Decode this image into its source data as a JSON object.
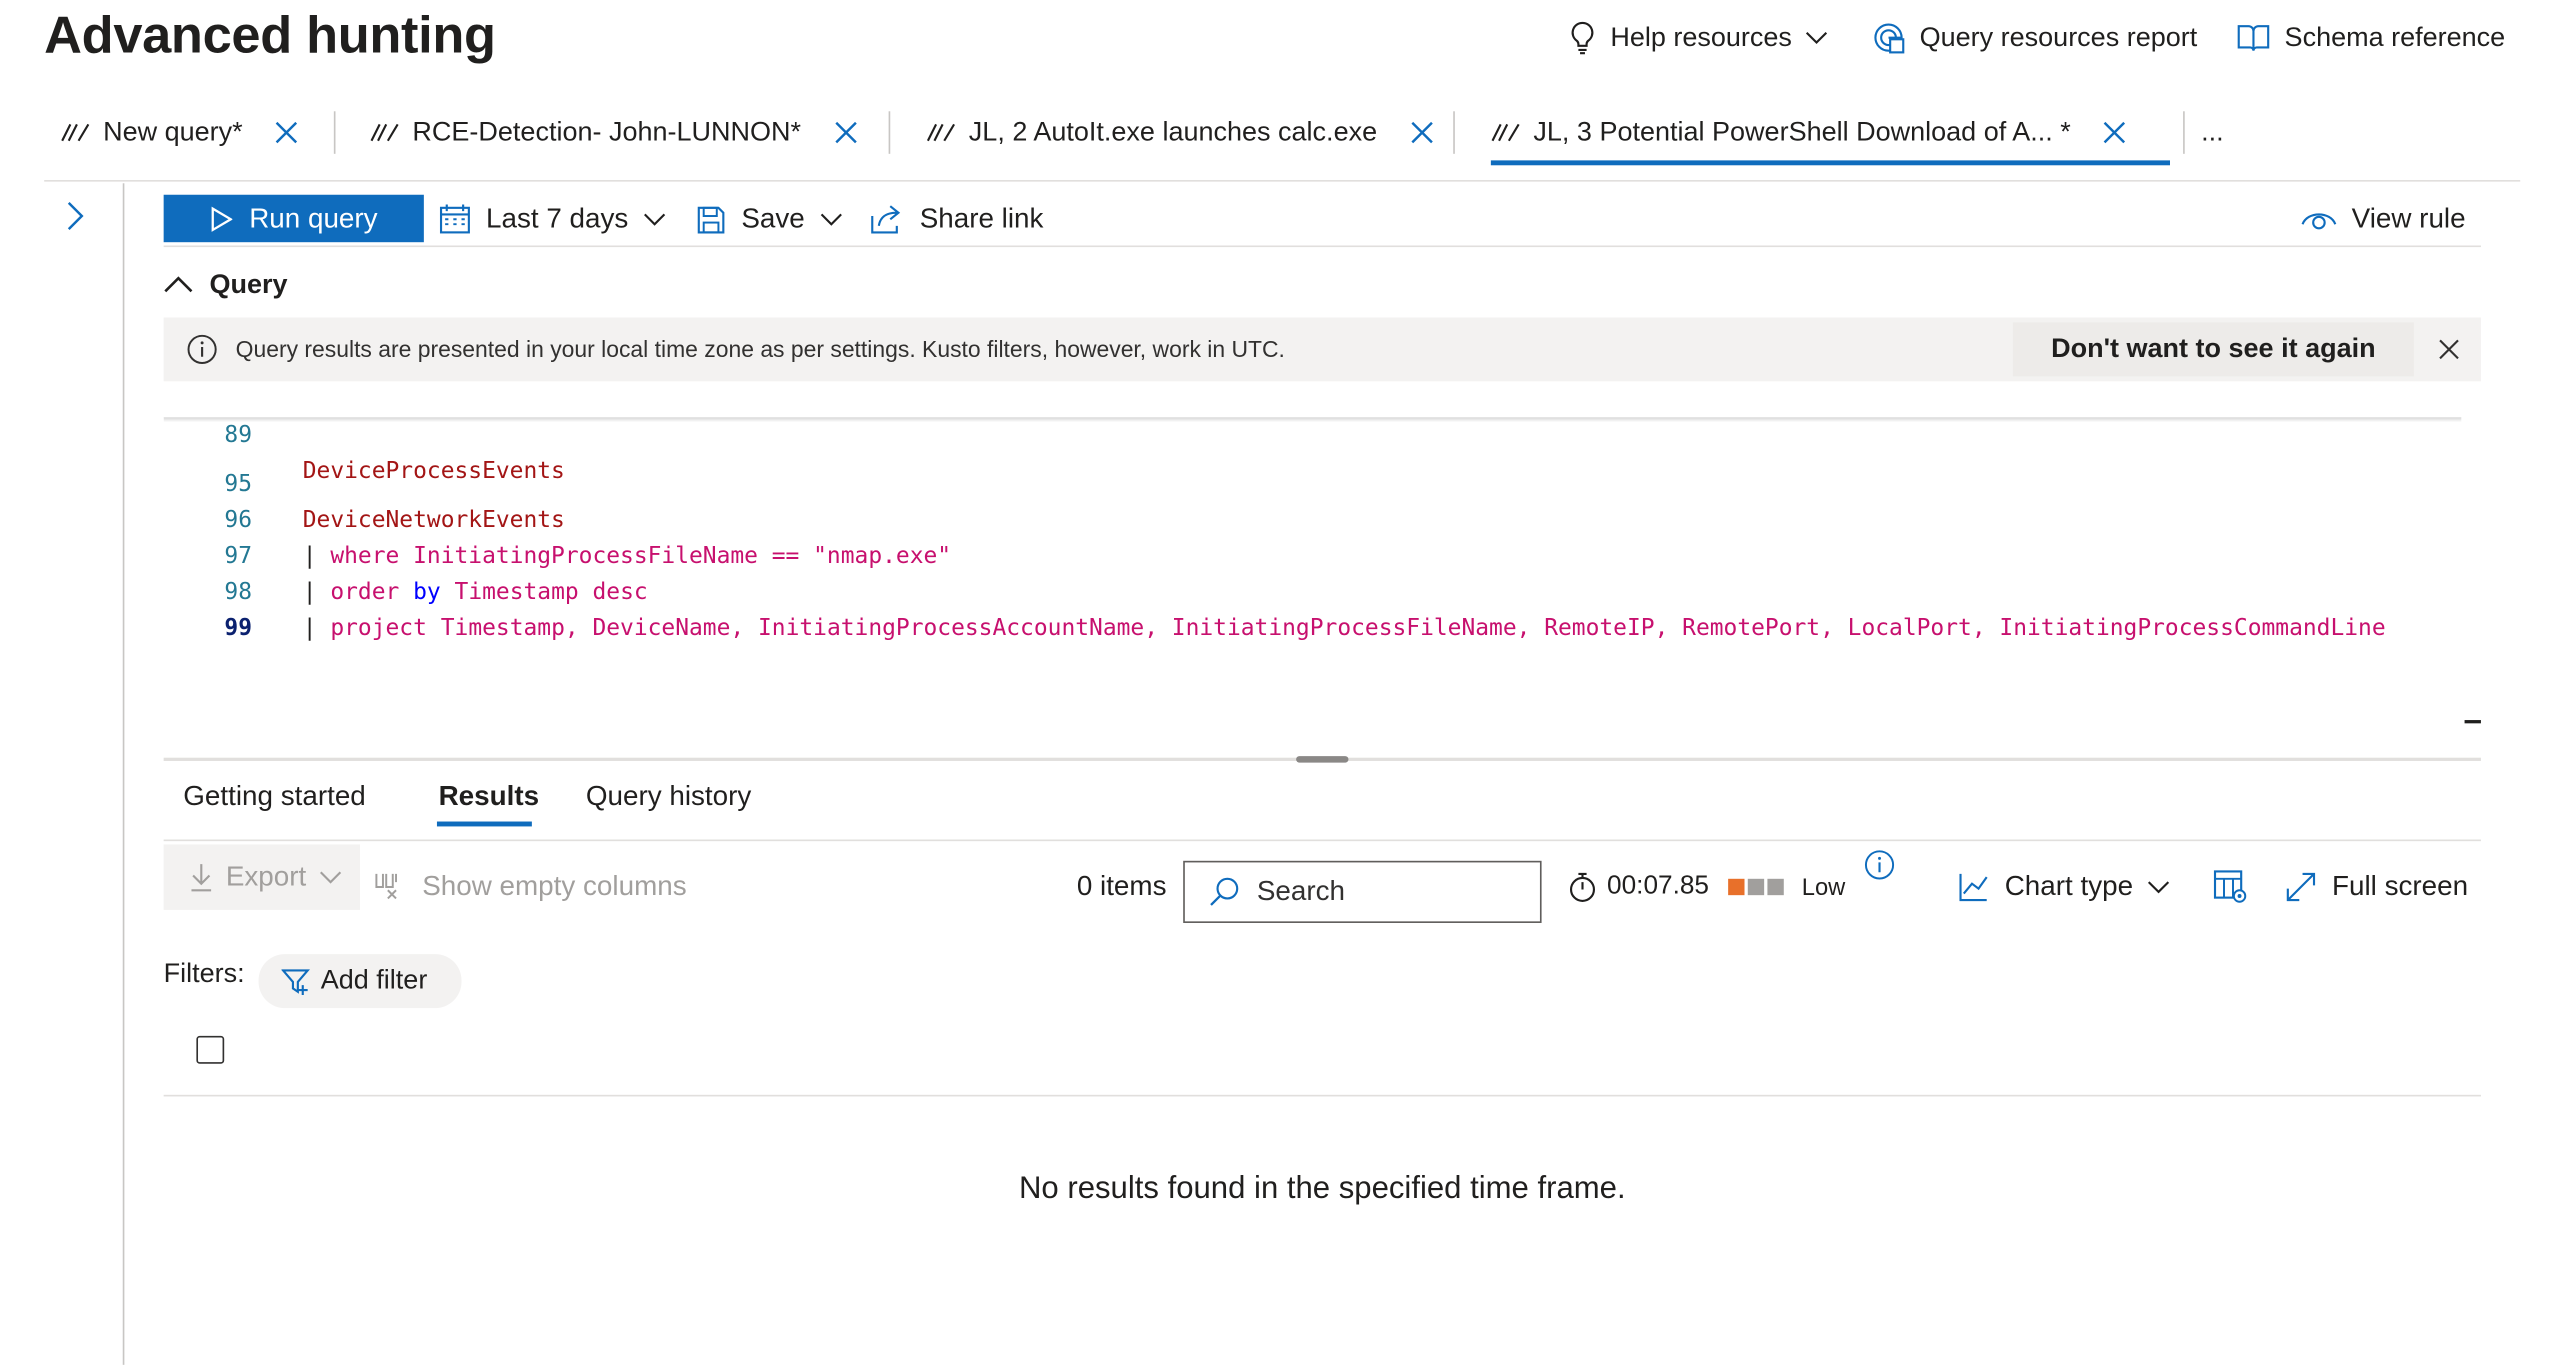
{
  "header": {
    "title": "Advanced hunting",
    "links": {
      "help": "Help resources",
      "report": "Query resources report",
      "schema": "Schema reference"
    }
  },
  "tabs": [
    {
      "label": "New query*"
    },
    {
      "label": "RCE-Detection- John-LUNNON*"
    },
    {
      "label": "JL, 2 AutoIt.exe launches calc.exe"
    },
    {
      "label": "JL, 3 Potential PowerShell Download of A...  *"
    }
  ],
  "tabs_more": "...",
  "toolbar": {
    "run": "Run query",
    "timerange": "Last 7 days",
    "save": "Save",
    "share": "Share link",
    "view_rule": "View rule"
  },
  "query_section": {
    "label": "Query",
    "info": "Query results are presented in your local time zone as per settings. Kusto filters, however, work in UTC.",
    "dismiss": "Don't want to see it again"
  },
  "editor": {
    "lines": [
      {
        "n": "89",
        "text": "DeviceProcessEvents"
      },
      {
        "n": "95",
        "text": "DeviceNetworkEvents"
      },
      {
        "n": "96",
        "pipe": "| ",
        "kw": "where",
        "rest": " InitiatingProcessFileName == \"nmap.exe\""
      },
      {
        "n": "97",
        "pipe": "| ",
        "kw": "order",
        "kw2": "by",
        "col": "Timestamp",
        "kw3": "desc"
      },
      {
        "n": "98",
        "pipe": "| ",
        "kw": "project",
        "cols": "Timestamp, DeviceName, InitiatingProcessAccountName, InitiatingProcessFileName, RemoteIP, RemotePort, LocalPort, InitiatingProcessCommandLine"
      },
      {
        "n": "99",
        "text": ""
      }
    ]
  },
  "result_tabs": [
    "Getting started",
    "Results",
    "Query history"
  ],
  "results_toolbar": {
    "export": "Export",
    "show_empty": "Show empty columns",
    "items": "0 items",
    "search_placeholder": "Search",
    "time": "00:07.85",
    "level": "Low",
    "chart_type": "Chart type",
    "full_screen": "Full screen"
  },
  "filters": {
    "label": "Filters:",
    "add": "Add filter"
  },
  "empty_message": "No results found in the specified time frame.",
  "colors": {
    "accent": "#0f6cbd",
    "usage_low": "#e8702a",
    "usage_empty": "#a19f9d"
  }
}
